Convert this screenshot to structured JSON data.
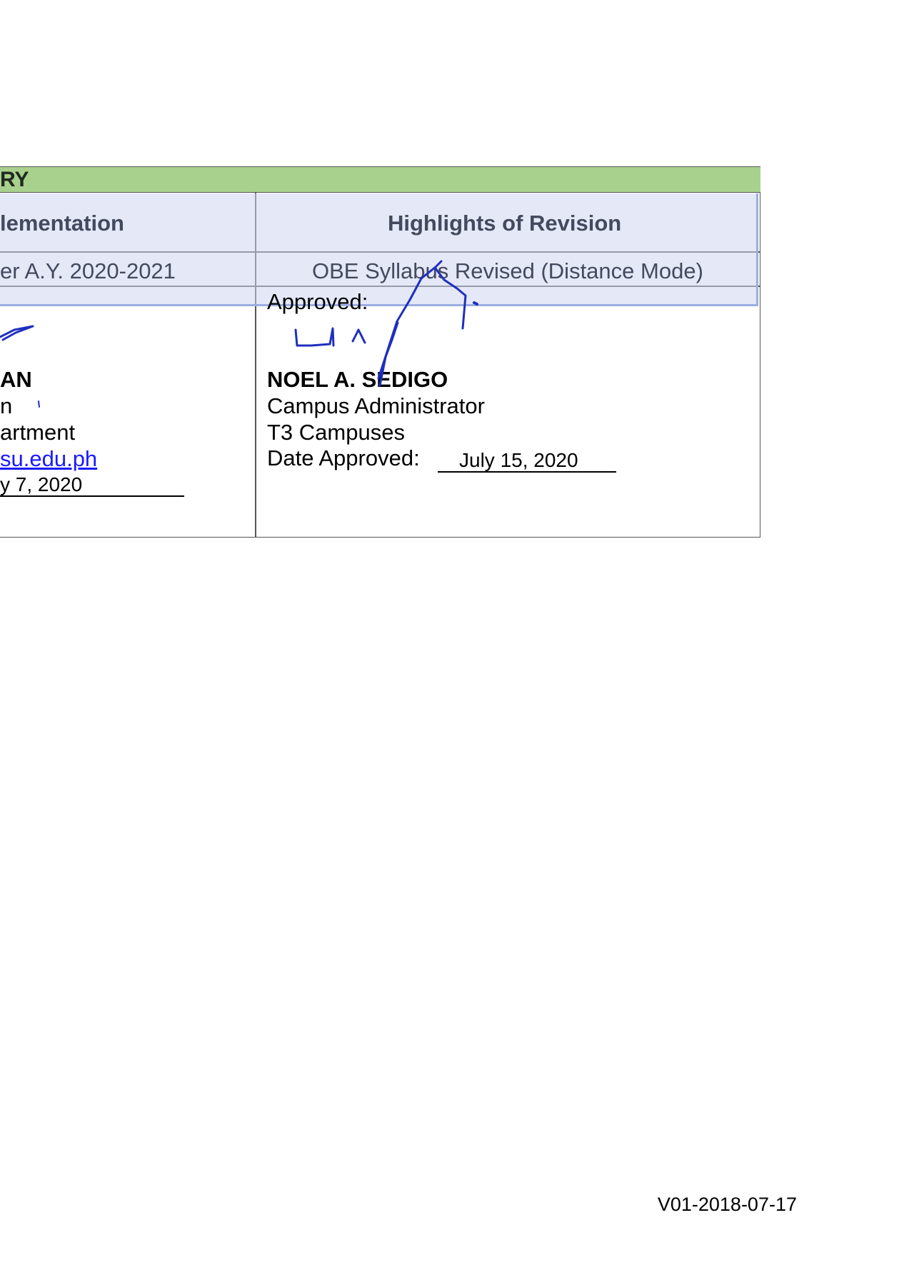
{
  "section": {
    "title": "RY"
  },
  "headers": {
    "left": "lementation",
    "right": "Highlights of Revision"
  },
  "row": {
    "left": "er A.Y. 2020-2021",
    "right": "OBE Syllabus Revised (Distance Mode)"
  },
  "left_signatory": {
    "name": "AN",
    "title": "n",
    "department": "artment",
    "email": "su.edu.ph",
    "date": "y 7, 2020"
  },
  "right_signatory": {
    "approved_label": "Approved:",
    "name": "NOEL A. SEDIGO",
    "title": "Campus Administrator",
    "campus": "T3 Campuses",
    "date_label": "Date Approved:",
    "date_value": "July 15, 2020"
  },
  "footer": {
    "version": "V01-2018-07-17"
  },
  "colors": {
    "section_bar": "#a9d18e",
    "highlight": "#cdd5f0",
    "link": "#1a1aff",
    "ink": "#1f2fbf"
  }
}
